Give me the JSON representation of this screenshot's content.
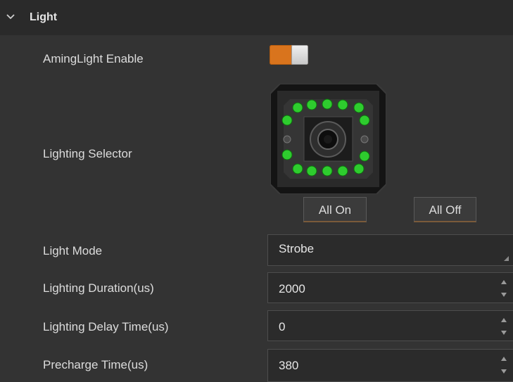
{
  "section": {
    "title": "Light",
    "expanded": true
  },
  "rows": {
    "aming_light_enable": {
      "label": "AmingLight Enable",
      "value": true
    },
    "lighting_selector": {
      "label": "Lighting Selector",
      "all_on_label": "All On",
      "all_off_label": "All Off"
    },
    "light_mode": {
      "label": "Light Mode",
      "value": "Strobe"
    },
    "lighting_duration": {
      "label": "Lighting Duration(us)",
      "value": "2000"
    },
    "lighting_delay": {
      "label": "Lighting Delay Time(us)",
      "value": "0"
    },
    "precharge_time": {
      "label": "Precharge Time(us)",
      "value": "380"
    }
  },
  "colors": {
    "accent": "#d9741d",
    "led_on": "#2ecc2e",
    "led_off": "#555555",
    "background": "#333333"
  }
}
